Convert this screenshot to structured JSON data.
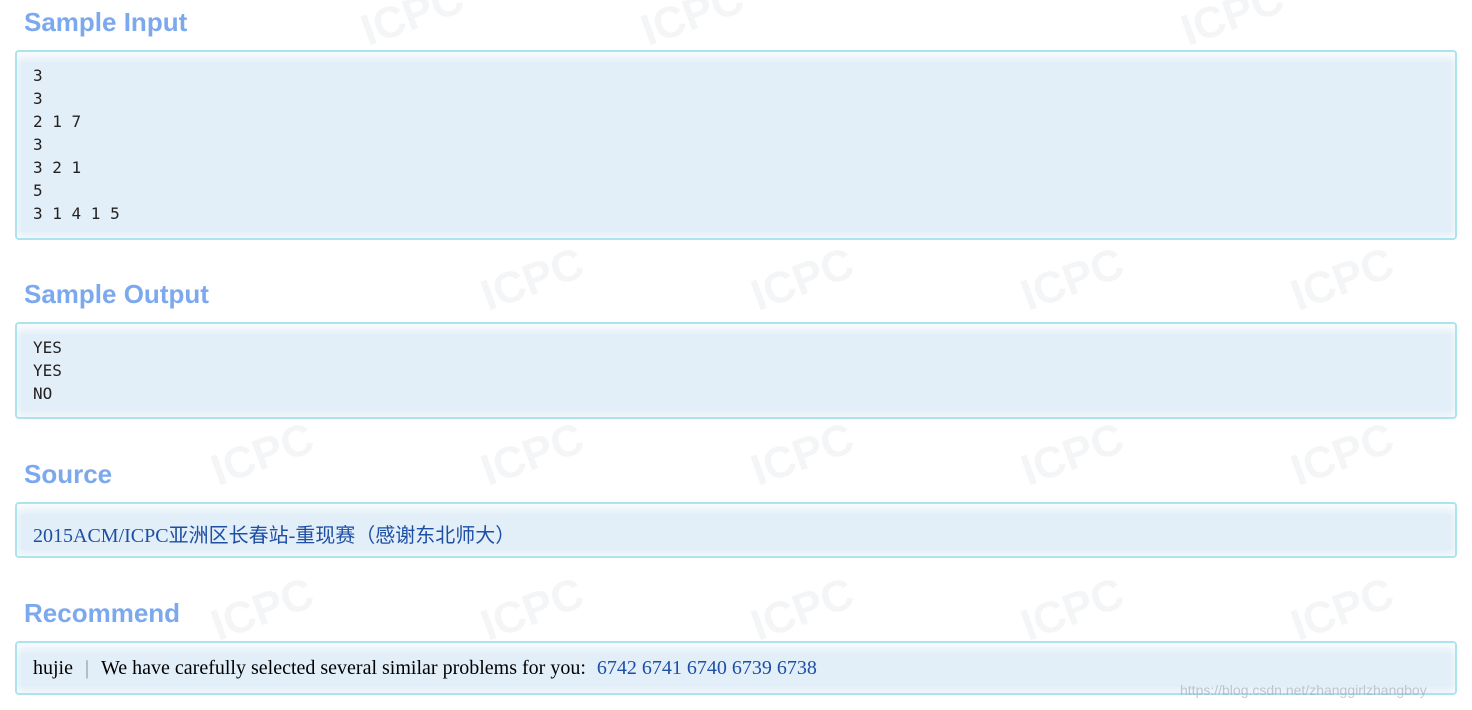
{
  "sample_input": {
    "heading": "Sample Input",
    "lines": [
      "3",
      "3",
      "2 1 7",
      "3",
      "3 2 1",
      "5",
      "3 1 4 1 5"
    ]
  },
  "sample_output": {
    "heading": "Sample Output",
    "lines": [
      "YES",
      "YES",
      "NO"
    ]
  },
  "source": {
    "heading": "Source",
    "link_text": "2015ACM/ICPC亚洲区长春站-重现赛（感谢东北师大）"
  },
  "recommend": {
    "heading": "Recommend",
    "author": "hujie",
    "separator": "|",
    "intro": "We have carefully selected several similar problems for you:",
    "problems": [
      "6742",
      "6741",
      "6740",
      "6739",
      "6738"
    ]
  },
  "watermark": {
    "text": "ICPC",
    "footer_url": "https://blog.csdn.net/zhanggirlzhangboy"
  },
  "colors": {
    "heading": "#7ca9ed",
    "panel_border": "#ade3ef",
    "panel_fill": "#e3eff8",
    "link": "#1e4fa5"
  }
}
